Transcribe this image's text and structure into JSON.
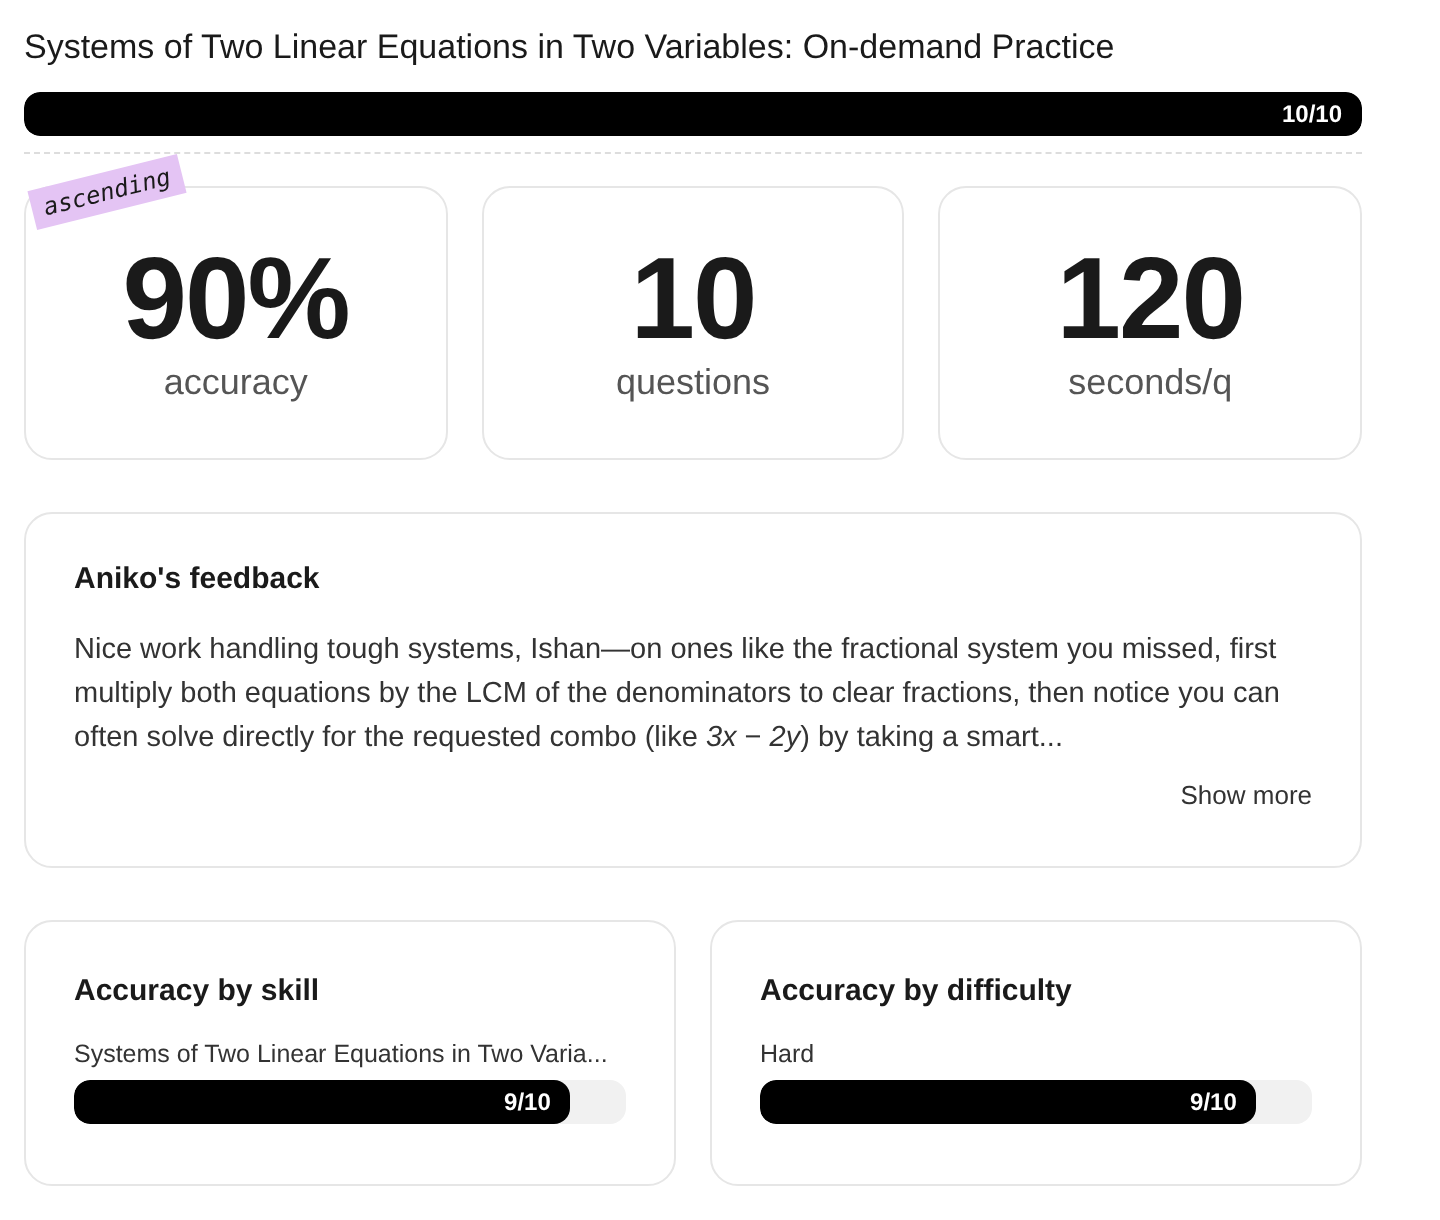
{
  "title": "Systems of Two Linear Equations in Two Variables: On-demand Practice",
  "overall_progress": {
    "level": 1,
    "reading": "10/10"
  },
  "stats": [
    {
      "value": "90%",
      "label": "accuracy",
      "tag": "ascending"
    },
    {
      "value": "10",
      "label": "questions"
    },
    {
      "value": "120",
      "label": "seconds/q"
    }
  ],
  "feedback": {
    "title": "Aniko's feedback",
    "text": "Nice work handling tough systems, Ishan—on ones like the fractional system you missed, first multiply both equations by the LCM of the denominators to clear fractions, then notice you can often solve directly for the requested combo (like *3x* − *2y*) by taking a smart...",
    "show_more": "Show more"
  },
  "breakdowns": [
    {
      "title": "Accuracy by skill",
      "rows": [
        {
          "label": "Systems of Two Linear Equations in Two Varia...",
          "level": 0.9,
          "reading": "9/10"
        }
      ]
    },
    {
      "title": "Accuracy by difficulty",
      "rows": [
        {
          "label": "Hard",
          "level": 0.9,
          "reading": "9/10"
        }
      ]
    }
  ]
}
